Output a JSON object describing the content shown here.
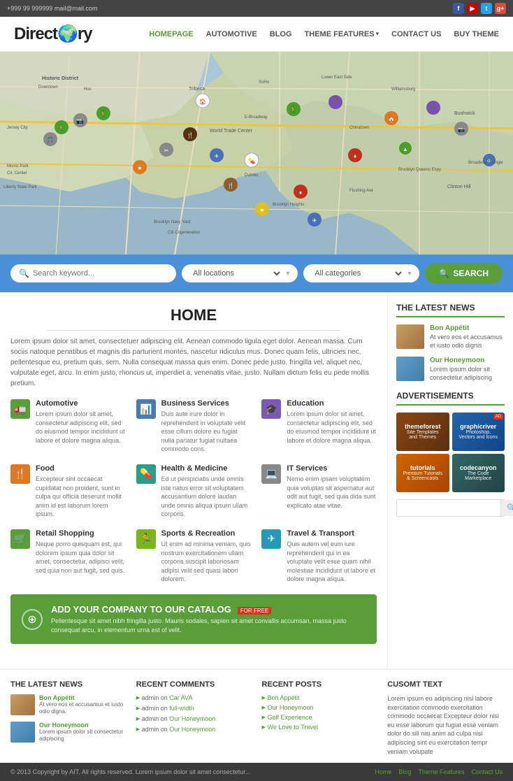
{
  "topbar": {
    "contact": "+999 99 999999 mail@mail.com"
  },
  "nav": {
    "logo": "Direct",
    "logo_globe": "🌍",
    "logo_rest": "ry",
    "links": [
      {
        "label": "HOMEPAGE",
        "active": true
      },
      {
        "label": "AUTOMOTIVE",
        "active": false
      },
      {
        "label": "BLOG",
        "active": false
      },
      {
        "label": "THEME FEATURES",
        "active": false,
        "dropdown": true
      },
      {
        "label": "CONTACT US",
        "active": false
      },
      {
        "label": "BUY THEME",
        "active": false
      }
    ]
  },
  "search": {
    "keyword_placeholder": "Search keyword...",
    "location_placeholder": "All locations",
    "category_placeholder": "All categories",
    "button_label": "SEARCH"
  },
  "home": {
    "title": "HOME",
    "body_text": "Lorem ipsum dolor sit amet, consectetuer adipiscing elit. Aenean commodo ligula eget dolor. Aenean massa. Cum sociis natoque penatibus et magnis dis parturient montes, nascetur ridiculus mus. Donec quam felis, ultricies nec, pellentesque eu, pretium quis, sem. Nulla consequat massa quis enim. Donec pede justo, fringilla vel, aliquet nec, vulputate eget, arcu. In enim justo, rhoncus ut, imperdiet a, venenatis vitae, justo. Nullam dictum felis eu pede mollis pretium."
  },
  "categories": [
    {
      "id": "automotive",
      "label": "Automotive",
      "icon": "🚛",
      "color": "green",
      "text": "Lorem ipsum dolor sit amet, consectetur adipiscing elit, sed do eiusmod tempor incididunt ut labore et dolore magna aliqua."
    },
    {
      "id": "business",
      "label": "Business Services",
      "icon": "📊",
      "color": "blue",
      "text": "Duis aute irure dolor in reprehenderit in voluptate velit esse cillum dolore eu fugiat nulla pariatur fugiat nultaea commodo cons."
    },
    {
      "id": "education",
      "label": "Education",
      "icon": "🎓",
      "color": "purple",
      "text": "Lorem ipsum dolor sit amet, consectetur adipiscing elit, sed do eiusmod tempor incididunt ut labore et dolore magna aliqua."
    },
    {
      "id": "food",
      "label": "Food",
      "icon": "🍴",
      "color": "orange",
      "text": "Excepteur sint occaecat cupidatat non proident, sunt in culpa qui officia deserunt mollit anim id est laborum lorem ipsum."
    },
    {
      "id": "health",
      "label": "Health & Medicine",
      "icon": "💊",
      "color": "teal",
      "text": "Ed ut perspiciatis unde omnis iste natus error sit voluptatem accusantium dolore laudan unde omnis aliqua ipsum ullam corporis."
    },
    {
      "id": "it",
      "label": "IT Services",
      "icon": "💻",
      "color": "gray",
      "text": "Nemo enim ipsam voluptatem quia voluptas sit aspernatur aut odit aut fugit, sed quia dida sunt explicato atae vitae."
    },
    {
      "id": "retail",
      "label": "Retail Shopping",
      "icon": "🛒",
      "color": "green",
      "text": "Neque porro quisquam est, qui dolorem ipsum quia dolor sit amet, consectetur, adipisci velit, sed quia non aut fugit, sed quis."
    },
    {
      "id": "sports",
      "label": "Sports & Recreation",
      "icon": "🏃",
      "color": "lime",
      "text": "Ut enim ad minima veniam, quis nostrum exercitationem ullam corporis suscipit laboriosam adipisi velit sed quasi labori dolorem."
    },
    {
      "id": "travel",
      "label": "Travel & Transport",
      "icon": "✈",
      "color": "cyan",
      "text": "Quis autem vel eum iure reprehenderit qui in ea voluptate velit esse quam nihil molestiae incididunt ut labore et dolore magna aliqua."
    }
  ],
  "add_banner": {
    "title": "ADD YOUR COMPANY TO OUR CATALOG",
    "badge": "FOR FREE",
    "subtitle": "Pellentesque sit amet nibh fringilla justo. Mauris sodales, sapien sit amet convallis accumsan, massa justo consequat arcu, in elementum urna est of velit."
  },
  "latest_news": {
    "title": "THE LATEST NEWS",
    "items": [
      {
        "title": "Bon Appétit",
        "thumb_type": "food",
        "text": "At vero eos et accusamus et iusto odio dignis"
      },
      {
        "title": "Our Honeymoon",
        "thumb_type": "travel",
        "text": "Lorem ipsum dolor sit consectetur adipiscing"
      }
    ]
  },
  "advertisements": {
    "title": "ADVERTISEMENTS",
    "items": [
      {
        "id": "themeforest",
        "class": "ad-tf",
        "title": "themeforest",
        "sub": "Site Templates\nand Themes",
        "badge": ""
      },
      {
        "id": "graphicriver",
        "class": "ad-gr",
        "title": "graphicriver",
        "sub": "Photoshop,\nVectors and Icons",
        "badge": ""
      },
      {
        "id": "tutorials",
        "class": "ad-tu",
        "title": "tutorials",
        "sub": "Premium Tutorials\n& Screencasts",
        "badge": ""
      },
      {
        "id": "codecanyon",
        "class": "ad-cc",
        "title": "codecanyon",
        "sub": "The Code\nMarketplace",
        "badge": ""
      }
    ]
  },
  "footer": {
    "latest_news_title": "THE LATEST NEWS",
    "recent_comments_title": "RECENT COMMENTS",
    "recent_posts_title": "RECENT POSTS",
    "custom_text_title": "CUSOMT TEXT",
    "latest_news_items": [
      {
        "title": "Bon Appétit",
        "thumb": "food",
        "text": "At vero eos et accusamus et iusto odio digna."
      },
      {
        "title": "Our Honeymoon",
        "thumb": "travel",
        "text": "Lorem ipsum dolor sit consectetur adipiscing"
      }
    ],
    "recent_comments": [
      {
        "author": "admin",
        "link_text": "Car AVA",
        "link": "#"
      },
      {
        "author": "admin",
        "link_text": "full-width",
        "link": "#"
      },
      {
        "author": "admin",
        "link_text": "Our Honeymoon",
        "link": "#"
      },
      {
        "author": "admin",
        "link_text": "Our Honeymoon",
        "link": "#"
      }
    ],
    "recent_posts": [
      "Bon Appétit",
      "Our Honeymoon",
      "Golf Experience",
      "We Love to Travel"
    ],
    "custom_text": "Lorem ipsum eu adipiscing nisl labore exercitation commodo exercitation commodo occaecat Excepteur dolor nisi eu esse laborum qui fugiat esse veniam dolor do sill nisi anim ad culpa nisi adipiscing sint eu exercitation tempr veniam volupate",
    "copyright": "© 2013 Copyright by AIT. All rights reserved. Lorem ipsum dolor sit amet consectetur...",
    "nav_links": [
      "Home",
      "Blog",
      "Theme Features",
      "Contact Us"
    ]
  }
}
